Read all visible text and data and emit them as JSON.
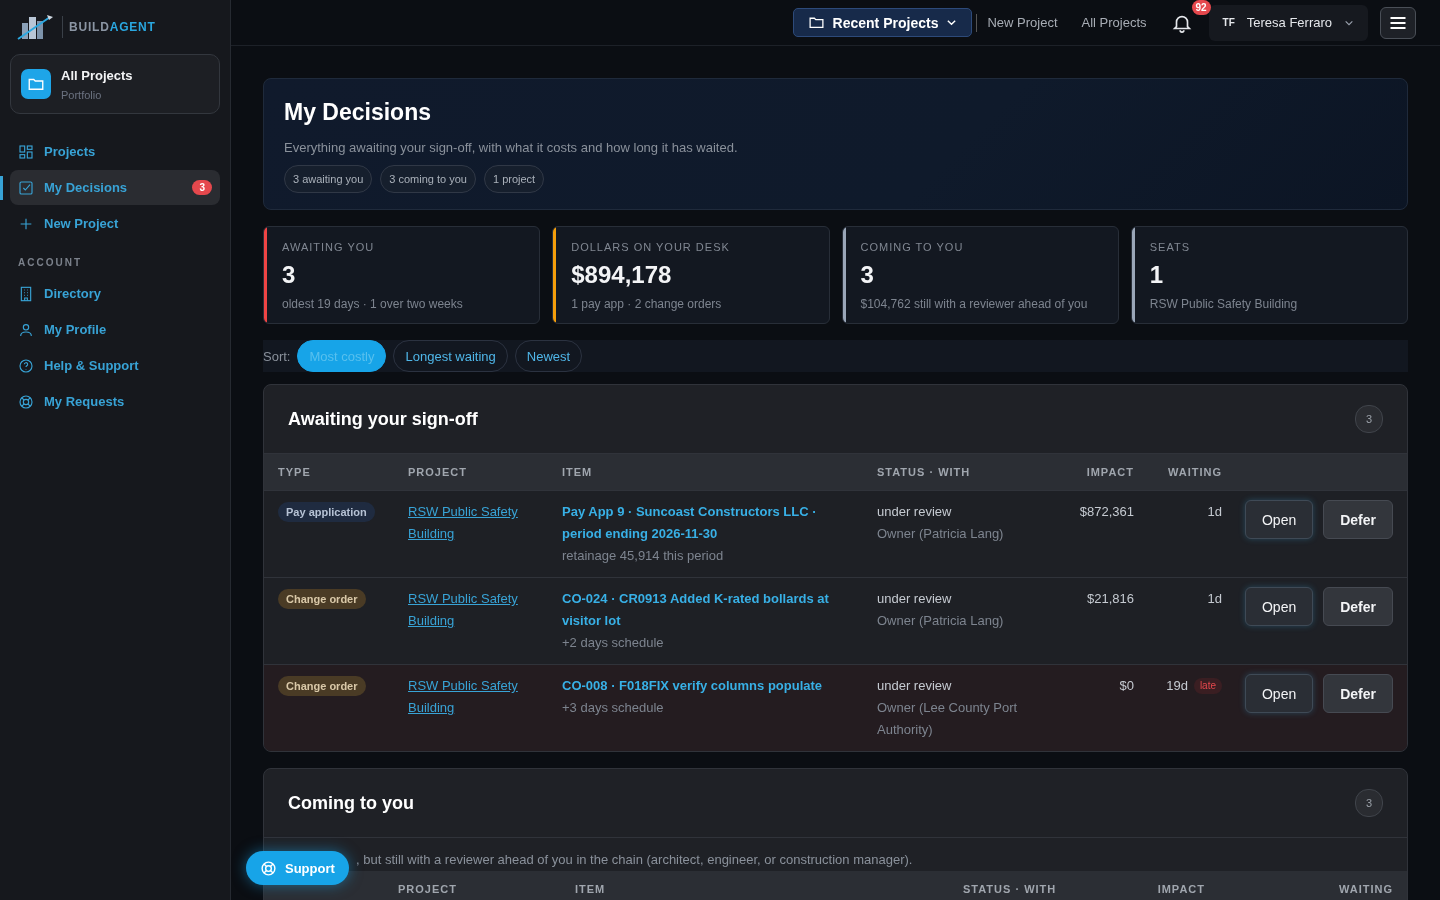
{
  "sidebar": {
    "logo": {
      "first": "BUILD",
      "second": "AGENT"
    },
    "workspace": {
      "title": "All Projects",
      "subtitle": "Portfolio"
    },
    "nav": [
      {
        "label": "Projects",
        "selected": false
      },
      {
        "label": "My Decisions",
        "selected": true,
        "badge": "3"
      },
      {
        "label": "New Project",
        "selected": false
      }
    ],
    "section_label": "ACCOUNT",
    "account": [
      {
        "label": "Directory",
        "selected": false
      },
      {
        "label": "My Profile",
        "selected": false
      },
      {
        "label": "Help & Support",
        "selected": false
      },
      {
        "label": "My Requests",
        "selected": false
      }
    ]
  },
  "topbar": {
    "recent": "Recent Projects",
    "links": [
      "New Project",
      "All Projects"
    ],
    "notifications": "92",
    "user": {
      "initials": "TF",
      "name": "Teresa Ferraro"
    }
  },
  "hero": {
    "title": "My Decisions",
    "subtitle": "Everything awaiting your sign-off, with what it costs and how long it has waited.",
    "chips": [
      "3 awaiting you",
      "3 coming to you",
      "1 project"
    ]
  },
  "stats": [
    {
      "label": "AWAITING YOU",
      "value": "3",
      "note": "oldest 19 days · 1 over two weeks",
      "color": "#ef4444"
    },
    {
      "label": "DOLLARS ON YOUR DESK",
      "value": "$894,178",
      "note": "1 pay app · 2 change orders",
      "color": "#f59e0b"
    },
    {
      "label": "COMING TO YOU",
      "value": "3",
      "note": "$104,762 still with a reviewer ahead of you",
      "color": "#9aa6b8"
    },
    {
      "label": "SEATS",
      "value": "1",
      "note": "RSW Public Safety Building",
      "color": "#9aa6b8"
    }
  ],
  "sort": {
    "label": "Sort:",
    "options": [
      {
        "label": "Most costly",
        "selected": true
      },
      {
        "label": "Longest waiting",
        "selected": false
      },
      {
        "label": "Newest",
        "selected": false
      }
    ]
  },
  "awaiting": {
    "title": "Awaiting your sign-off",
    "count": "3",
    "columns": [
      "TYPE",
      "PROJECT",
      "ITEM",
      "STATUS · WITH",
      "IMPACT",
      "WAITING"
    ],
    "rows": [
      {
        "type": "Pay application",
        "kind": "pay",
        "project": "RSW Public Safety Building",
        "item": "Pay App 9 · Suncoast Constructors LLC · period ending 2026-11-30",
        "detail": "retainage 45,914 this period",
        "status": "under review",
        "with": "Owner (Patricia Lang)",
        "impact": "$872,361",
        "waiting": "1d",
        "late": false,
        "actions": [
          "Open",
          "Defer"
        ]
      },
      {
        "type": "Change order",
        "kind": "change",
        "project": "RSW Public Safety Building",
        "item": "CO-024 · CR0913 Added K-rated bollards at visitor lot",
        "detail": "+2 days schedule",
        "status": "under review",
        "with": "Owner (Patricia Lang)",
        "impact": "$21,816",
        "waiting": "1d",
        "late": false,
        "actions": [
          "Open",
          "Defer"
        ]
      },
      {
        "type": "Change order",
        "kind": "change",
        "project": "RSW Public Safety Building",
        "item": "CO-008 · F018FIX verify columns populate",
        "detail": "+3 days schedule",
        "status": "under review",
        "with": "Owner (Lee County Port Authority)",
        "impact": "$0",
        "waiting": "19d",
        "late": true,
        "late_label": "late",
        "actions": [
          "Open",
          "Defer"
        ]
      }
    ]
  },
  "coming": {
    "title": "Coming to you",
    "count": "3",
    "note": ", but still with a reviewer ahead of you in the chain (architect, engineer, or construction manager).",
    "columns": [
      "PROJECT",
      "ITEM",
      "STATUS · WITH",
      "IMPACT",
      "WAITING"
    ]
  },
  "support": "Support"
}
